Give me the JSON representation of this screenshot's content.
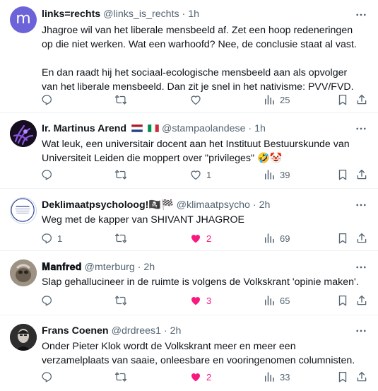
{
  "tweets": [
    {
      "name": "links=rechts",
      "handle": "@links_is_rechts",
      "time": "1h",
      "text": "Jhagroe wil van het liberale mensbeeld af. Zet een hoop redeneringen op die niet werken. Wat een warhoofd? Nee, de conclusie staat al vast.\n\nEn dan raadt hij het sociaal-ecologische mensbeeld aan als opvolger van het liberale mensbeeld. Dan zit je snel in het nativisme: PVV/FVD.",
      "avatar_letter": "m",
      "replies": "",
      "reposts": "",
      "likes": "",
      "views": "25",
      "liked": false
    },
    {
      "name": "Ir. Martinus Arend",
      "handle": "@stampaolandese",
      "time": "1h",
      "text": "Wat leuk, een universitair docent aan het Instituut Bestuurskunde van Universiteit Leiden die moppert over \"privileges\" 🤣🤡",
      "replies": "",
      "reposts": "",
      "likes": "1",
      "views": "39",
      "liked": false
    },
    {
      "name": "Deklimaatpsycholoog!🏴‍☠️🏁",
      "handle": "@klimaatpsycho",
      "time": "2h",
      "text": "Weg met de kapper van SHIVANT JHAGROE",
      "replies": "1",
      "reposts": "",
      "likes": "2",
      "views": "69",
      "liked": true
    },
    {
      "name": "𝐌𝐚𝐧𝐟𝐫𝐞𝐝",
      "handle": "@mterburg",
      "time": "2h",
      "text": "Slap gehallucineer in de ruimte is volgens de Volkskrant 'opinie maken'.",
      "replies": "",
      "reposts": "",
      "likes": "3",
      "views": "65",
      "liked": true
    },
    {
      "name": "Frans Coenen",
      "handle": "@drdrees1",
      "time": "2h",
      "text": "Onder Pieter Klok wordt de Volkskrant meer en meer een verzamelplaats van saaie, onleesbare en vooringenomen columnisten.",
      "replies": "",
      "reposts": "",
      "likes": "2",
      "views": "33",
      "liked": true
    }
  ],
  "separator": " · ",
  "colors": {
    "text": "#0f1419",
    "secondary": "#536471",
    "like": "#f91880",
    "divider": "#eff3f4",
    "avatar_purple": "#6d63d8"
  },
  "icons": [
    "reply-icon",
    "repost-icon",
    "like-icon",
    "views-icon",
    "bookmark-icon",
    "share-icon",
    "more-icon"
  ]
}
